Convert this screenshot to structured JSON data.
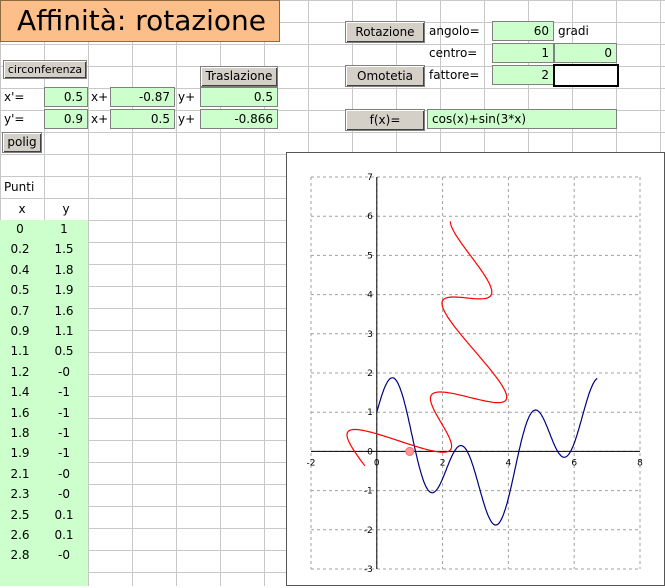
{
  "title": "Affinità: rotazione",
  "buttons": {
    "rotazione": "Rotazione",
    "omotetia": "Omotetia",
    "circonferenza": "circonferenza",
    "traslazione": "Traslazione",
    "fx": "f(x)=",
    "polig": "polig"
  },
  "params": {
    "angolo_label": "angolo=",
    "angolo_value": "60",
    "angolo_unit": "gradi",
    "centro_label": "centro=",
    "centro_x": "1",
    "centro_y": "0",
    "fattore_label": "fattore=",
    "fattore_value": "2",
    "function": "cos(x)+sin(3*x)"
  },
  "transform": {
    "xprime_label": "x'=",
    "yprime_label": "y'=",
    "xplus_label": "x+",
    "yplus_label": "y+",
    "r1c1": "0.5",
    "r1c2": "-0.87",
    "r1c3": "0.5",
    "r2c1": "0.9",
    "r2c2": "0.5",
    "r2c3": "-0.866"
  },
  "points": {
    "heading": "Punti",
    "col_x": "x",
    "col_y": "y",
    "rows": [
      [
        "0",
        "1"
      ],
      [
        "0.2",
        "1.5"
      ],
      [
        "0.4",
        "1.8"
      ],
      [
        "0.5",
        "1.9"
      ],
      [
        "0.7",
        "1.6"
      ],
      [
        "0.9",
        "1.1"
      ],
      [
        "1.1",
        "0.5"
      ],
      [
        "1.2",
        "-0"
      ],
      [
        "1.4",
        "-1"
      ],
      [
        "1.6",
        "-1"
      ],
      [
        "1.8",
        "-1"
      ],
      [
        "1.9",
        "-1"
      ],
      [
        "2.1",
        "-0"
      ],
      [
        "2.3",
        "-0"
      ],
      [
        "2.5",
        "0.1"
      ],
      [
        "2.6",
        "0.1"
      ],
      [
        "2.8",
        "-0"
      ]
    ]
  },
  "chart_data": {
    "type": "line",
    "xlim": [
      -2,
      8
    ],
    "ylim": [
      -3,
      7
    ],
    "xticks": [
      -2,
      0,
      2,
      4,
      6,
      8
    ],
    "yticks": [
      -3,
      -2,
      -1,
      0,
      1,
      2,
      3,
      4,
      5,
      6,
      7
    ],
    "grid": true,
    "series": [
      {
        "color": "#000080",
        "x_range": [
          0,
          6.7
        ],
        "values_desc": "y = cos(x)+sin(3x)"
      },
      {
        "color": "#ff0000",
        "transform": "rotation 60 degrees about (1,0) of blue curve"
      }
    ],
    "center_point": {
      "x": 1,
      "y": 0,
      "color": "#ff9999"
    }
  }
}
